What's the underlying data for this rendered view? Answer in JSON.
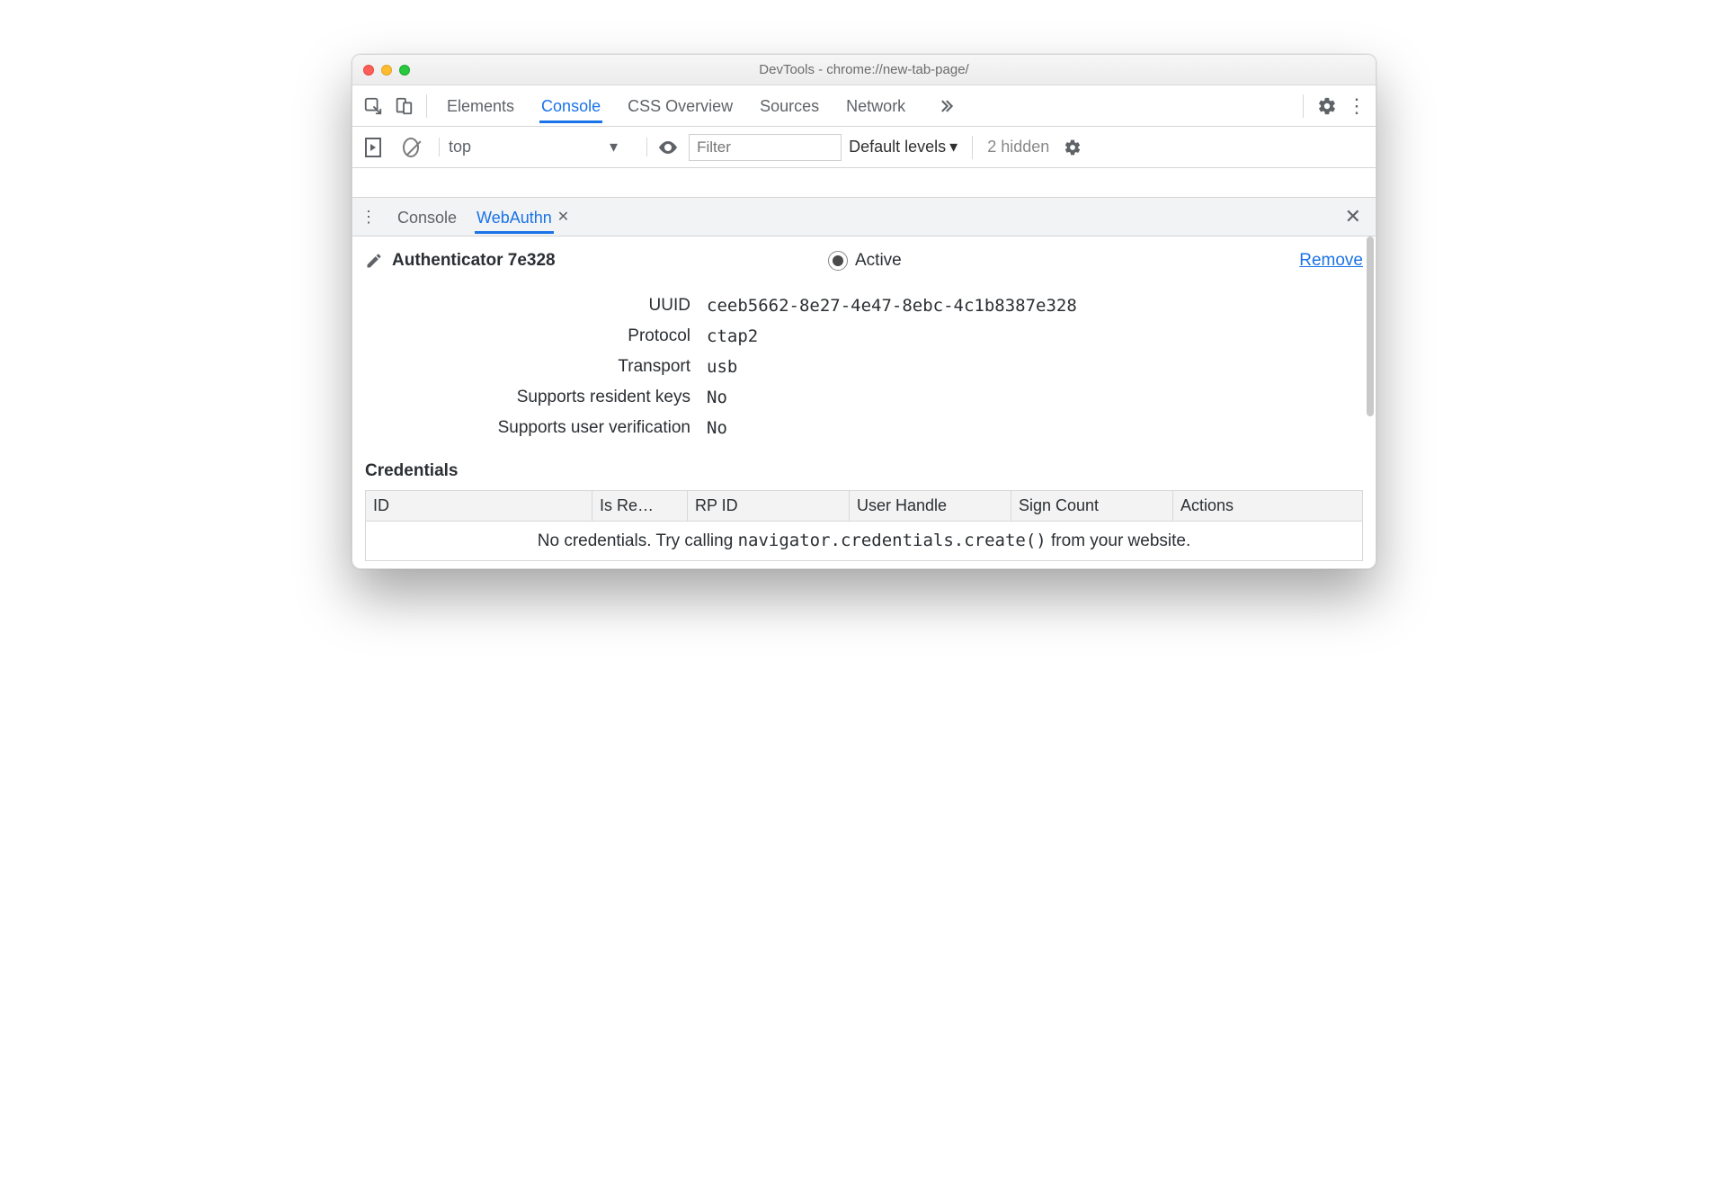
{
  "window": {
    "title": "DevTools - chrome://new-tab-page/"
  },
  "toolbar": {
    "tabs": [
      "Elements",
      "Console",
      "CSS Overview",
      "Sources",
      "Network"
    ],
    "active_tab": "Console"
  },
  "console_bar": {
    "context": "top",
    "filter_placeholder": "Filter",
    "levels": "Default levels",
    "hidden": "2 hidden"
  },
  "drawer": {
    "tabs": [
      "Console",
      "WebAuthn"
    ],
    "active_tab": "WebAuthn"
  },
  "authenticator": {
    "name": "Authenticator 7e328",
    "active_label": "Active",
    "remove_label": "Remove",
    "fields": {
      "uuid_label": "UUID",
      "uuid": "ceeb5662-8e27-4e47-8ebc-4c1b8387e328",
      "protocol_label": "Protocol",
      "protocol": "ctap2",
      "transport_label": "Transport",
      "transport": "usb",
      "resident_label": "Supports resident keys",
      "resident": "No",
      "uv_label": "Supports user verification",
      "uv": "No"
    }
  },
  "credentials": {
    "heading": "Credentials",
    "columns": {
      "id": "ID",
      "is_resident": "Is Re…",
      "rp_id": "RP ID",
      "user_handle": "User Handle",
      "sign_count": "Sign Count",
      "actions": "Actions"
    },
    "empty_prefix": "No credentials. Try calling ",
    "empty_code": "navigator.credentials.create()",
    "empty_suffix": " from your website."
  }
}
